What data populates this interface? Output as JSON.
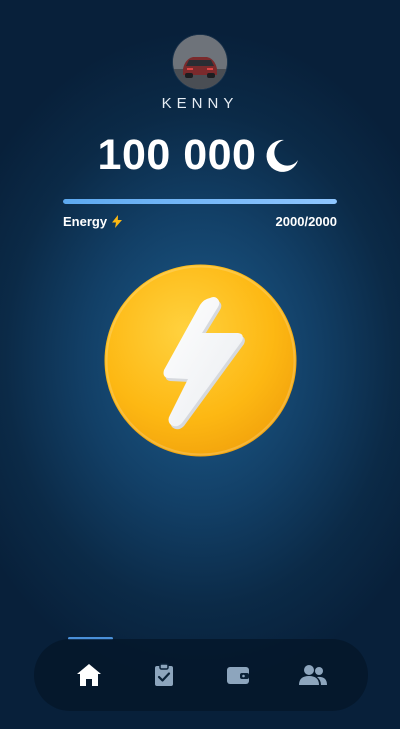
{
  "user": {
    "name": "KENNY"
  },
  "balance": {
    "value": "100 000",
    "currency_icon": "moon-icon"
  },
  "energy": {
    "label": "Energy",
    "icon": "lightning-icon",
    "count": "2000/2000",
    "current": 2000,
    "max": 2000
  },
  "tap_button": {
    "icon": "lightning-bolt-icon",
    "color": "#fdb813"
  },
  "nav": {
    "active_index": 0,
    "items": [
      {
        "name": "home",
        "icon": "home-icon"
      },
      {
        "name": "tasks",
        "icon": "clipboard-check-icon"
      },
      {
        "name": "wallet",
        "icon": "wallet-icon"
      },
      {
        "name": "friends",
        "icon": "users-icon"
      }
    ]
  },
  "colors": {
    "accent": "#4a90d9",
    "coin": "#fdb813",
    "background": "#0b2a47"
  }
}
